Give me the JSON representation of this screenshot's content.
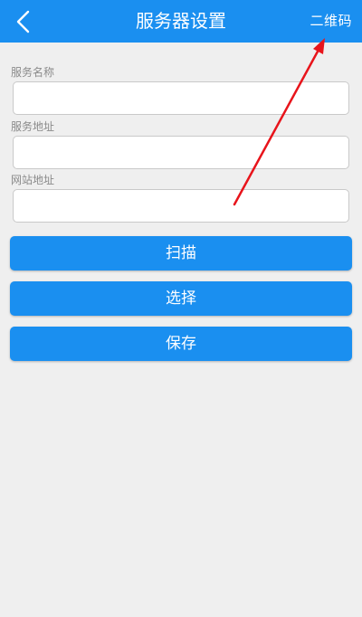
{
  "header": {
    "title": "服务器设置",
    "right_action": "二维码",
    "back_icon": "chevron-left-icon"
  },
  "form": {
    "fields": [
      {
        "label": "服务名称",
        "value": ""
      },
      {
        "label": "服务地址",
        "value": ""
      },
      {
        "label": "网站地址",
        "value": ""
      }
    ]
  },
  "actions": {
    "scan": "扫描",
    "select": "选择",
    "save": "保存"
  },
  "colors": {
    "accent": "#1a8ff0",
    "background": "#efefef",
    "annotation_arrow": "#e8141b"
  }
}
